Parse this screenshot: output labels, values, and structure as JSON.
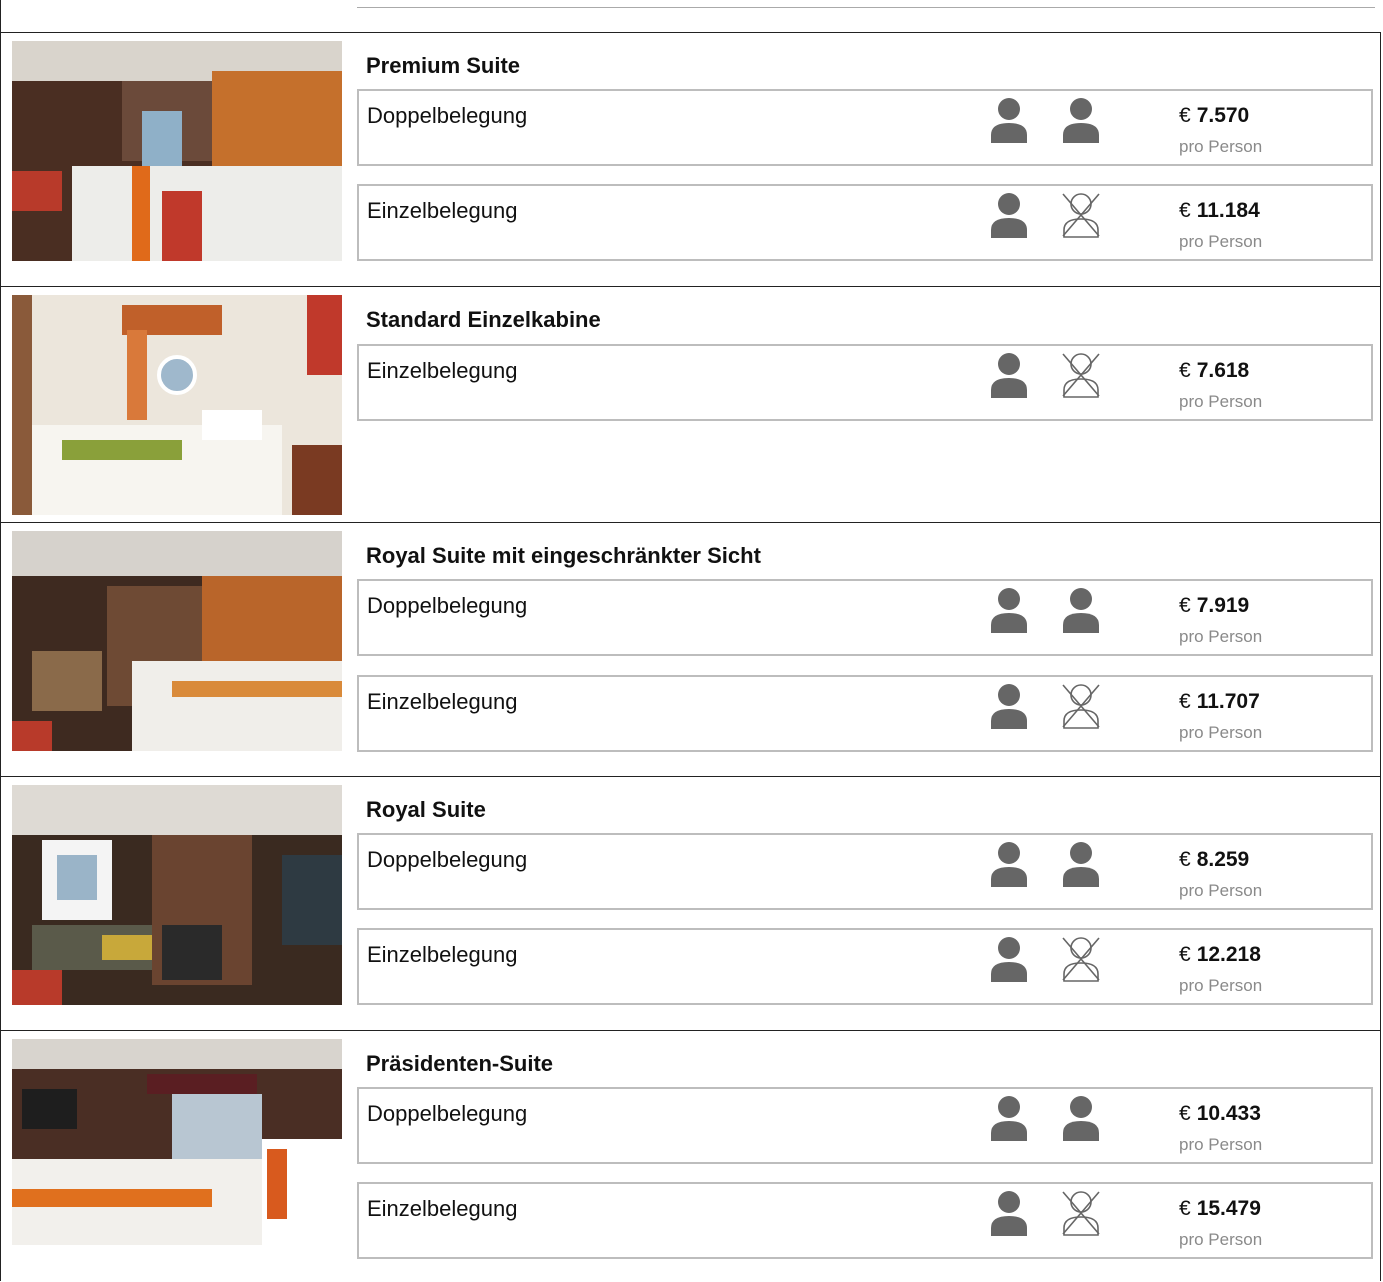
{
  "price_unit": "pro Person",
  "currency": "€",
  "icons": {
    "occupied": "person-icon",
    "unoccupied": "person-crossed-icon"
  },
  "colors": {
    "icon": "#666666",
    "border": "#bdbdbd",
    "muted": "#8a8a8a"
  },
  "cabins": [
    {
      "name": "Premium Suite",
      "rates": [
        {
          "label": "Doppelbelegung",
          "price": "7.570",
          "persons": 2
        },
        {
          "label": "Einzelbelegung",
          "price": "11.184",
          "persons": 1
        }
      ]
    },
    {
      "name": "Standard Einzelkabine",
      "rates": [
        {
          "label": "Einzelbelegung",
          "price": "7.618",
          "persons": 1
        }
      ]
    },
    {
      "name": "Royal Suite mit eingeschränkter Sicht",
      "rates": [
        {
          "label": "Doppelbelegung",
          "price": "7.919",
          "persons": 2
        },
        {
          "label": "Einzelbelegung",
          "price": "11.707",
          "persons": 1
        }
      ]
    },
    {
      "name": "Royal Suite",
      "rates": [
        {
          "label": "Doppelbelegung",
          "price": "8.259",
          "persons": 2
        },
        {
          "label": "Einzelbelegung",
          "price": "12.218",
          "persons": 1
        }
      ]
    },
    {
      "name": "Präsidenten-Suite",
      "rates": [
        {
          "label": "Doppelbelegung",
          "price": "10.433",
          "persons": 2
        },
        {
          "label": "Einzelbelegung",
          "price": "15.479",
          "persons": 1
        }
      ]
    }
  ]
}
